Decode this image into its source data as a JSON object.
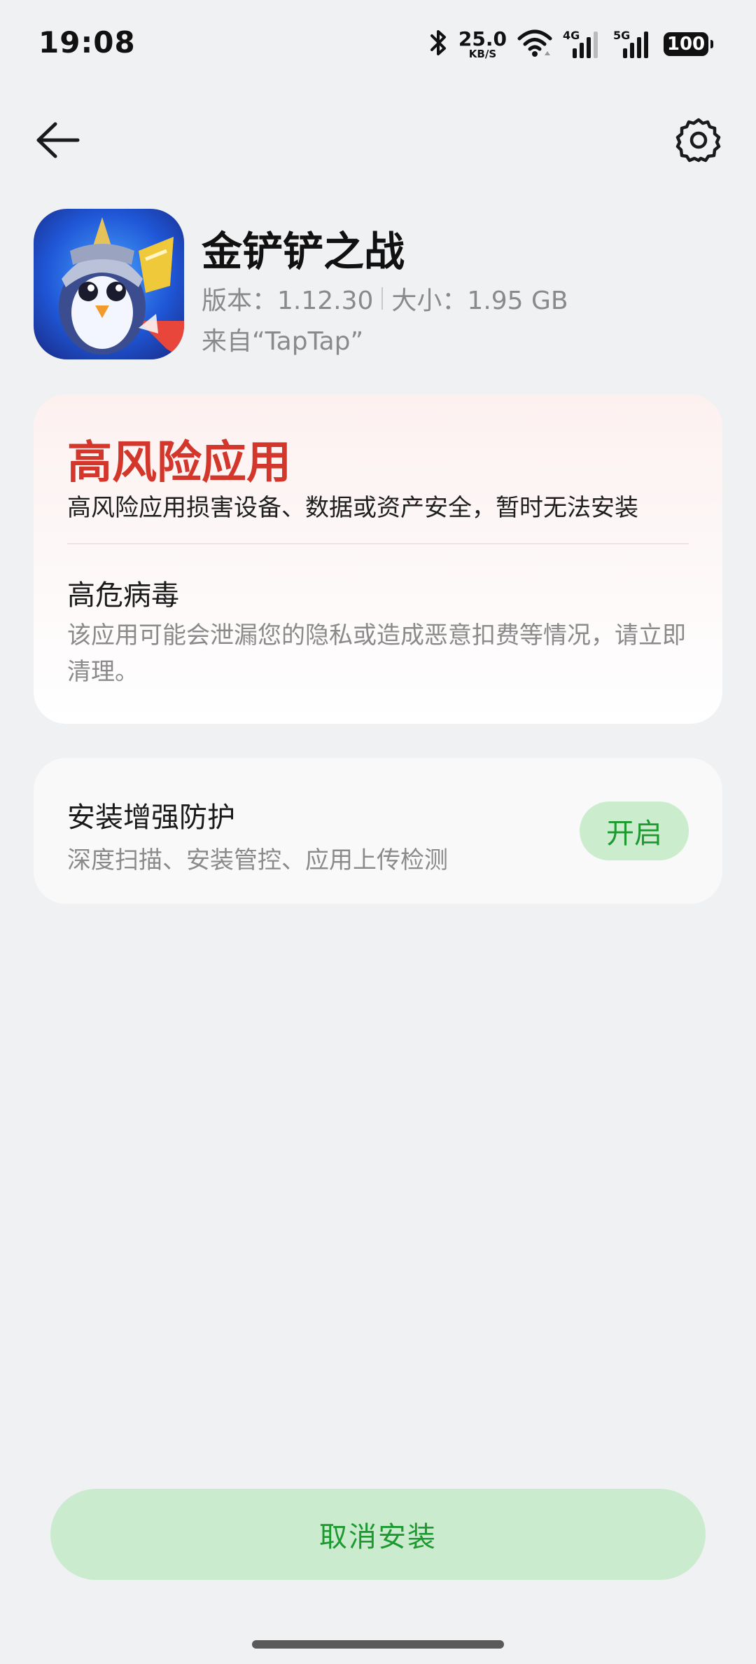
{
  "status_bar": {
    "time": "19:08",
    "net_speed_value": "25.0",
    "net_speed_unit": "KB/S",
    "signal1_label": "4G",
    "signal2_label": "5G",
    "battery": "100"
  },
  "app": {
    "name": "金铲铲之战",
    "version": "版本：1.12.30",
    "size": "大小：1.95 GB",
    "source": "来自“TapTap”"
  },
  "risk": {
    "title": "高风险应用",
    "description": "高风险应用损害设备、数据或资产安全，暂时无法安装",
    "virus_title": "高危病毒",
    "virus_description": "该应用可能会泄漏您的隐私或造成恶意扣费等情况，请立即清理。"
  },
  "protection": {
    "title": "安装增强防护",
    "description": "深度扫描、安装管控、应用上传检测",
    "enable_label": "开启"
  },
  "footer": {
    "cancel_label": "取消安装"
  },
  "colors": {
    "risk_red": "#d3372c",
    "accent_green": "#1d9a2f",
    "button_green_bg": "#cbebce",
    "page_bg": "#f0f1f3"
  }
}
